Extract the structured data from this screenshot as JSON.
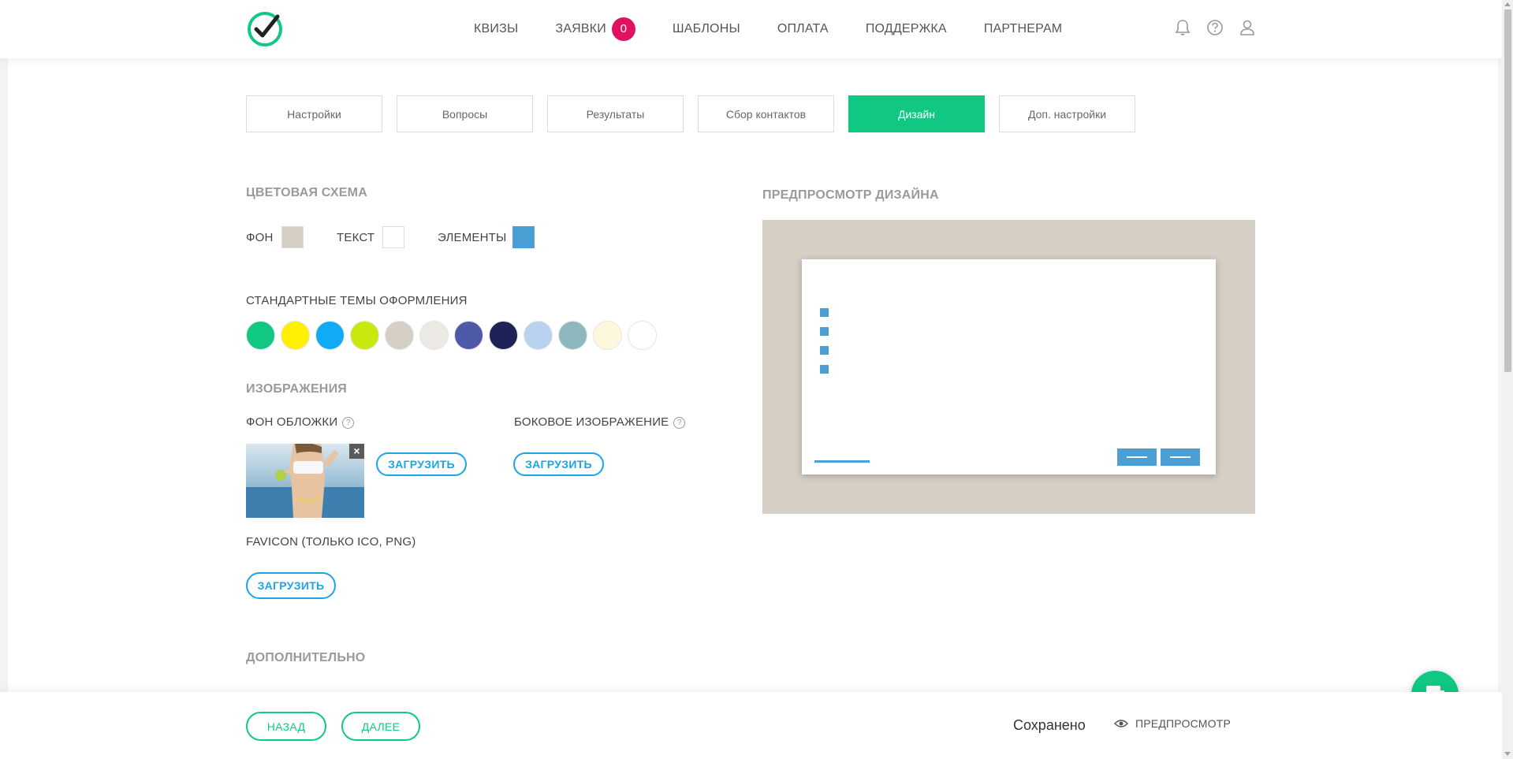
{
  "header": {
    "nav": [
      {
        "label": "КВИЗЫ"
      },
      {
        "label": "ЗАЯВКИ",
        "badge": "0"
      },
      {
        "label": "ШАБЛОНЫ"
      },
      {
        "label": "ОПЛАТА"
      },
      {
        "label": "ПОДДЕРЖКА"
      },
      {
        "label": "ПАРТНЕРАМ"
      }
    ],
    "icons": [
      "bell-icon",
      "help-icon",
      "user-icon"
    ]
  },
  "tabs": [
    "Настройки",
    "Вопросы",
    "Результаты",
    "Сбор контактов",
    "Дизайн",
    "Доп. настройки"
  ],
  "active_tab": "Дизайн",
  "color_scheme": {
    "title": "ЦВЕТОВАЯ СХЕМА",
    "bg_label": "ФОН",
    "bg_color": "#d6cfc5",
    "text_label": "ТЕКСТ",
    "text_color": "#ffffff",
    "elements_label": "ЭЛЕМЕНТЫ",
    "elements_color": "#4c9fd5"
  },
  "themes": {
    "title": "СТАНДАРТНЫЕ ТЕМЫ ОФОРМЛЕНИЯ",
    "colors": [
      "#10c882",
      "#ffef00",
      "#10aaf5",
      "#c9e80e",
      "#d6cfc5",
      "#ece9e4",
      "#4e5aa7",
      "#1f2257",
      "#b9d2f0",
      "#8fb7be",
      "#fdf8dc",
      "#ffffff"
    ]
  },
  "images": {
    "title": "ИЗОБРАЖЕНИЯ",
    "cover_label": "ФОН ОБЛОЖКИ",
    "side_label": "БОКОВОЕ ИЗОБРАЖЕНИЕ",
    "upload_label": "ЗАГРУЗИТЬ",
    "favicon_label": "FAVICON (ТОЛЬКО ICO, PNG)"
  },
  "preview": {
    "title": "ПРЕДПРОСМОТР ДИЗАЙНА"
  },
  "additional": {
    "title": "ДОПОЛНИТЕЛЬНО"
  },
  "footer": {
    "back_label": "НАЗАД",
    "next_label": "ДАЛЕЕ",
    "status": "Сохранено",
    "preview_label": "ПРЕДПРОСМОТР"
  },
  "colors": {
    "accent": "#10c882",
    "link": "#1aa5e6",
    "badge": "#e0115f"
  }
}
